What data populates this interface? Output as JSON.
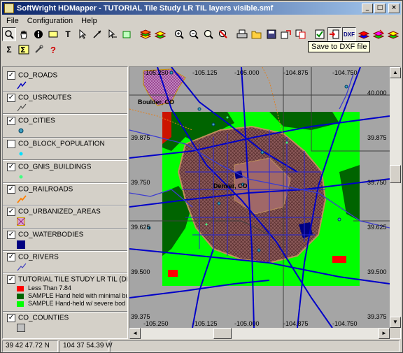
{
  "window": {
    "title": "SoftWright HDMapper - TUTORIAL Tile Study LR TIL layers visible.smf"
  },
  "caption_buttons": {
    "minimize": "_",
    "maximize": "□",
    "close": "×"
  },
  "menu": [
    {
      "label": "File"
    },
    {
      "label": "Configuration"
    },
    {
      "label": "Help"
    }
  ],
  "toolbar": {
    "tooltip": "Save to DXF file",
    "text_tool": "T",
    "sum_tool": "Σ",
    "help_tool": "?",
    "dxf_tool": "DXF"
  },
  "legend": {
    "layers": [
      {
        "name": "CO_ROADS",
        "checked": true
      },
      {
        "name": "CO_USROUTES",
        "checked": true
      },
      {
        "name": "CO_CITIES",
        "checked": true
      },
      {
        "name": "CO_BLOCK_POPULATION",
        "checked": false
      },
      {
        "name": "CO_GNIS_BUILDINGS",
        "checked": true
      },
      {
        "name": "CO_RAILROADS",
        "checked": true
      },
      {
        "name": "CO_URBANIZED_AREAS",
        "checked": true
      },
      {
        "name": "CO_WATERBODIES",
        "checked": true
      },
      {
        "name": "CO_RIVERS",
        "checked": true
      },
      {
        "name": "TUTORIAL TILE STUDY LR TIL (DBU_",
        "checked": true
      },
      {
        "name": "CO_COUNTIES",
        "checked": true
      }
    ],
    "tile_classes": [
      {
        "label": "Less Than 7.84",
        "color": "#ff0000"
      },
      {
        "label": "SAMPLE Hand held with minimal bu",
        "color": "#006400"
      },
      {
        "label": "SAMPLE Hand-held w/ severe bod",
        "color": "#00ff00"
      }
    ]
  },
  "map": {
    "top_labels": [
      "-105.250",
      "-105.125",
      "-105.000",
      "-104.875",
      "-104.750"
    ],
    "bottom_labels": [
      "-105.250",
      "-105.125",
      "-105.000",
      "-104.875",
      "-104.750"
    ],
    "left_labels": [
      "39.875",
      "39.750",
      "39.625",
      "39.500",
      "39.375"
    ],
    "right_labels": [
      "40.000",
      "39.875",
      "39.750",
      "39.625",
      "39.500",
      "39.375"
    ],
    "cities": [
      "Boulder, CO",
      "Denver, CO"
    ]
  },
  "status": {
    "latitude": "39 42 47.72 N",
    "longitude": "104 37 54.39 W"
  }
}
